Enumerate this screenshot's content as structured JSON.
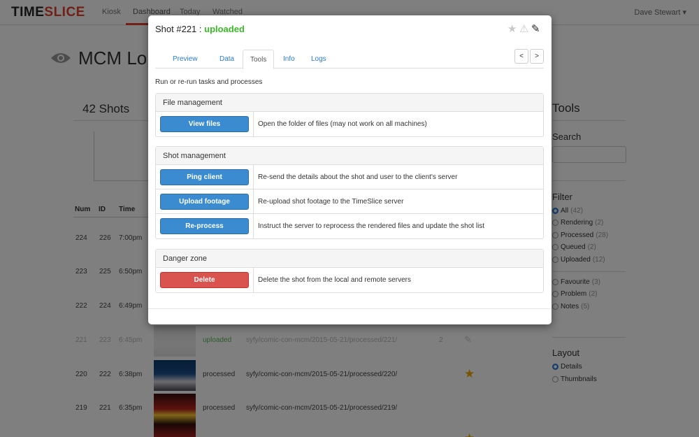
{
  "app": {
    "brand_time": "TIME",
    "brand_slice": "SLICE",
    "nav": [
      "Kiosk",
      "Dashboard",
      "Today",
      "Watched"
    ],
    "user": "Dave Stewart ▾"
  },
  "page": {
    "title": "MCM Lon",
    "shots_count": "42 Shots",
    "table_headers": [
      "Num",
      "ID",
      "Time"
    ],
    "rows": [
      {
        "num": "224",
        "id": "226",
        "time": "7:00pm",
        "status": "",
        "path": "",
        "count": ""
      },
      {
        "num": "223",
        "id": "225",
        "time": "6:50pm",
        "status": "",
        "path": "",
        "count": ""
      },
      {
        "num": "222",
        "id": "224",
        "time": "6:49pm",
        "status": "",
        "path": "",
        "count": ""
      },
      {
        "num": "221",
        "id": "223",
        "time": "6:45pm",
        "status": "uploaded",
        "path": "syfy/comic-con-mcm/2015-05-21/processed/221/",
        "count": "2"
      },
      {
        "num": "220",
        "id": "222",
        "time": "6:38pm",
        "status": "processed",
        "path": "syfy/comic-con-mcm/2015-05-21/processed/220/",
        "count": ""
      },
      {
        "num": "219",
        "id": "221",
        "time": "6:35pm",
        "status": "processed",
        "path": "syfy/comic-con-mcm/2015-05-21/processed/219/",
        "count": ""
      }
    ]
  },
  "sidebar": {
    "title": "Tools",
    "search_label": "Search",
    "filter_label": "Filter",
    "filters": [
      {
        "label": "All",
        "count": "(42)"
      },
      {
        "label": "Rendering",
        "count": "(2)"
      },
      {
        "label": "Processed",
        "count": "(28)"
      },
      {
        "label": "Queued",
        "count": "(2)"
      },
      {
        "label": "Uploaded",
        "count": "(12)"
      }
    ],
    "extra_filters": [
      {
        "label": "Favourite",
        "count": "(3)"
      },
      {
        "label": "Problem",
        "count": "(2)"
      },
      {
        "label": "Notes",
        "count": "(5)"
      }
    ],
    "layout_label": "Layout",
    "layouts": [
      "Details",
      "Thumbnails"
    ]
  },
  "modal": {
    "title_prefix": "Shot #221 : ",
    "title_status": "uploaded",
    "tabs": [
      "Preview",
      "Data",
      "Tools",
      "Info",
      "Logs"
    ],
    "pager_prev": "<",
    "pager_next": ">",
    "intro": "Run or re-run tasks and processes",
    "panels": {
      "file": {
        "heading": "File management",
        "rows": [
          {
            "button": "View files",
            "desc": "Open the folder of files (may not work on all machines)"
          }
        ]
      },
      "shot": {
        "heading": "Shot management",
        "rows": [
          {
            "button": "Ping client",
            "desc": "Re-send the details about the shot and user to the client's server"
          },
          {
            "button": "Upload footage",
            "desc": "Re-upload shot footage to the TimeSlice server"
          },
          {
            "button": "Re-process",
            "desc": "Instruct the server to reprocess the rendered files and update the shot list"
          }
        ]
      },
      "danger": {
        "heading": "Danger zone",
        "rows": [
          {
            "button": "Delete",
            "desc": "Delete the shot from the local and remote servers"
          }
        ]
      }
    }
  },
  "colors": {
    "brand": "#e0402e",
    "primary": "#3a8bd0",
    "danger": "#d9534f",
    "status_uploaded": "#3cb82a",
    "favourite": "#f0a800"
  }
}
